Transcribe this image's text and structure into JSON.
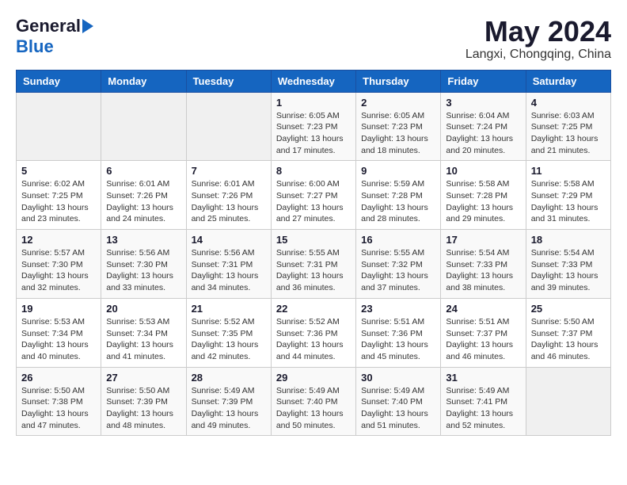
{
  "header": {
    "logo_general": "General",
    "logo_blue": "Blue",
    "month": "May 2024",
    "location": "Langxi, Chongqing, China"
  },
  "weekdays": [
    "Sunday",
    "Monday",
    "Tuesday",
    "Wednesday",
    "Thursday",
    "Friday",
    "Saturday"
  ],
  "weeks": [
    [
      {
        "day": "",
        "sunrise": "",
        "sunset": "",
        "daylight": ""
      },
      {
        "day": "",
        "sunrise": "",
        "sunset": "",
        "daylight": ""
      },
      {
        "day": "",
        "sunrise": "",
        "sunset": "",
        "daylight": ""
      },
      {
        "day": "1",
        "sunrise": "Sunrise: 6:05 AM",
        "sunset": "Sunset: 7:23 PM",
        "daylight": "Daylight: 13 hours and 17 minutes."
      },
      {
        "day": "2",
        "sunrise": "Sunrise: 6:05 AM",
        "sunset": "Sunset: 7:23 PM",
        "daylight": "Daylight: 13 hours and 18 minutes."
      },
      {
        "day": "3",
        "sunrise": "Sunrise: 6:04 AM",
        "sunset": "Sunset: 7:24 PM",
        "daylight": "Daylight: 13 hours and 20 minutes."
      },
      {
        "day": "4",
        "sunrise": "Sunrise: 6:03 AM",
        "sunset": "Sunset: 7:25 PM",
        "daylight": "Daylight: 13 hours and 21 minutes."
      }
    ],
    [
      {
        "day": "5",
        "sunrise": "Sunrise: 6:02 AM",
        "sunset": "Sunset: 7:25 PM",
        "daylight": "Daylight: 13 hours and 23 minutes."
      },
      {
        "day": "6",
        "sunrise": "Sunrise: 6:01 AM",
        "sunset": "Sunset: 7:26 PM",
        "daylight": "Daylight: 13 hours and 24 minutes."
      },
      {
        "day": "7",
        "sunrise": "Sunrise: 6:01 AM",
        "sunset": "Sunset: 7:26 PM",
        "daylight": "Daylight: 13 hours and 25 minutes."
      },
      {
        "day": "8",
        "sunrise": "Sunrise: 6:00 AM",
        "sunset": "Sunset: 7:27 PM",
        "daylight": "Daylight: 13 hours and 27 minutes."
      },
      {
        "day": "9",
        "sunrise": "Sunrise: 5:59 AM",
        "sunset": "Sunset: 7:28 PM",
        "daylight": "Daylight: 13 hours and 28 minutes."
      },
      {
        "day": "10",
        "sunrise": "Sunrise: 5:58 AM",
        "sunset": "Sunset: 7:28 PM",
        "daylight": "Daylight: 13 hours and 29 minutes."
      },
      {
        "day": "11",
        "sunrise": "Sunrise: 5:58 AM",
        "sunset": "Sunset: 7:29 PM",
        "daylight": "Daylight: 13 hours and 31 minutes."
      }
    ],
    [
      {
        "day": "12",
        "sunrise": "Sunrise: 5:57 AM",
        "sunset": "Sunset: 7:30 PM",
        "daylight": "Daylight: 13 hours and 32 minutes."
      },
      {
        "day": "13",
        "sunrise": "Sunrise: 5:56 AM",
        "sunset": "Sunset: 7:30 PM",
        "daylight": "Daylight: 13 hours and 33 minutes."
      },
      {
        "day": "14",
        "sunrise": "Sunrise: 5:56 AM",
        "sunset": "Sunset: 7:31 PM",
        "daylight": "Daylight: 13 hours and 34 minutes."
      },
      {
        "day": "15",
        "sunrise": "Sunrise: 5:55 AM",
        "sunset": "Sunset: 7:31 PM",
        "daylight": "Daylight: 13 hours and 36 minutes."
      },
      {
        "day": "16",
        "sunrise": "Sunrise: 5:55 AM",
        "sunset": "Sunset: 7:32 PM",
        "daylight": "Daylight: 13 hours and 37 minutes."
      },
      {
        "day": "17",
        "sunrise": "Sunrise: 5:54 AM",
        "sunset": "Sunset: 7:33 PM",
        "daylight": "Daylight: 13 hours and 38 minutes."
      },
      {
        "day": "18",
        "sunrise": "Sunrise: 5:54 AM",
        "sunset": "Sunset: 7:33 PM",
        "daylight": "Daylight: 13 hours and 39 minutes."
      }
    ],
    [
      {
        "day": "19",
        "sunrise": "Sunrise: 5:53 AM",
        "sunset": "Sunset: 7:34 PM",
        "daylight": "Daylight: 13 hours and 40 minutes."
      },
      {
        "day": "20",
        "sunrise": "Sunrise: 5:53 AM",
        "sunset": "Sunset: 7:34 PM",
        "daylight": "Daylight: 13 hours and 41 minutes."
      },
      {
        "day": "21",
        "sunrise": "Sunrise: 5:52 AM",
        "sunset": "Sunset: 7:35 PM",
        "daylight": "Daylight: 13 hours and 42 minutes."
      },
      {
        "day": "22",
        "sunrise": "Sunrise: 5:52 AM",
        "sunset": "Sunset: 7:36 PM",
        "daylight": "Daylight: 13 hours and 44 minutes."
      },
      {
        "day": "23",
        "sunrise": "Sunrise: 5:51 AM",
        "sunset": "Sunset: 7:36 PM",
        "daylight": "Daylight: 13 hours and 45 minutes."
      },
      {
        "day": "24",
        "sunrise": "Sunrise: 5:51 AM",
        "sunset": "Sunset: 7:37 PM",
        "daylight": "Daylight: 13 hours and 46 minutes."
      },
      {
        "day": "25",
        "sunrise": "Sunrise: 5:50 AM",
        "sunset": "Sunset: 7:37 PM",
        "daylight": "Daylight: 13 hours and 46 minutes."
      }
    ],
    [
      {
        "day": "26",
        "sunrise": "Sunrise: 5:50 AM",
        "sunset": "Sunset: 7:38 PM",
        "daylight": "Daylight: 13 hours and 47 minutes."
      },
      {
        "day": "27",
        "sunrise": "Sunrise: 5:50 AM",
        "sunset": "Sunset: 7:39 PM",
        "daylight": "Daylight: 13 hours and 48 minutes."
      },
      {
        "day": "28",
        "sunrise": "Sunrise: 5:49 AM",
        "sunset": "Sunset: 7:39 PM",
        "daylight": "Daylight: 13 hours and 49 minutes."
      },
      {
        "day": "29",
        "sunrise": "Sunrise: 5:49 AM",
        "sunset": "Sunset: 7:40 PM",
        "daylight": "Daylight: 13 hours and 50 minutes."
      },
      {
        "day": "30",
        "sunrise": "Sunrise: 5:49 AM",
        "sunset": "Sunset: 7:40 PM",
        "daylight": "Daylight: 13 hours and 51 minutes."
      },
      {
        "day": "31",
        "sunrise": "Sunrise: 5:49 AM",
        "sunset": "Sunset: 7:41 PM",
        "daylight": "Daylight: 13 hours and 52 minutes."
      },
      {
        "day": "",
        "sunrise": "",
        "sunset": "",
        "daylight": ""
      }
    ]
  ]
}
